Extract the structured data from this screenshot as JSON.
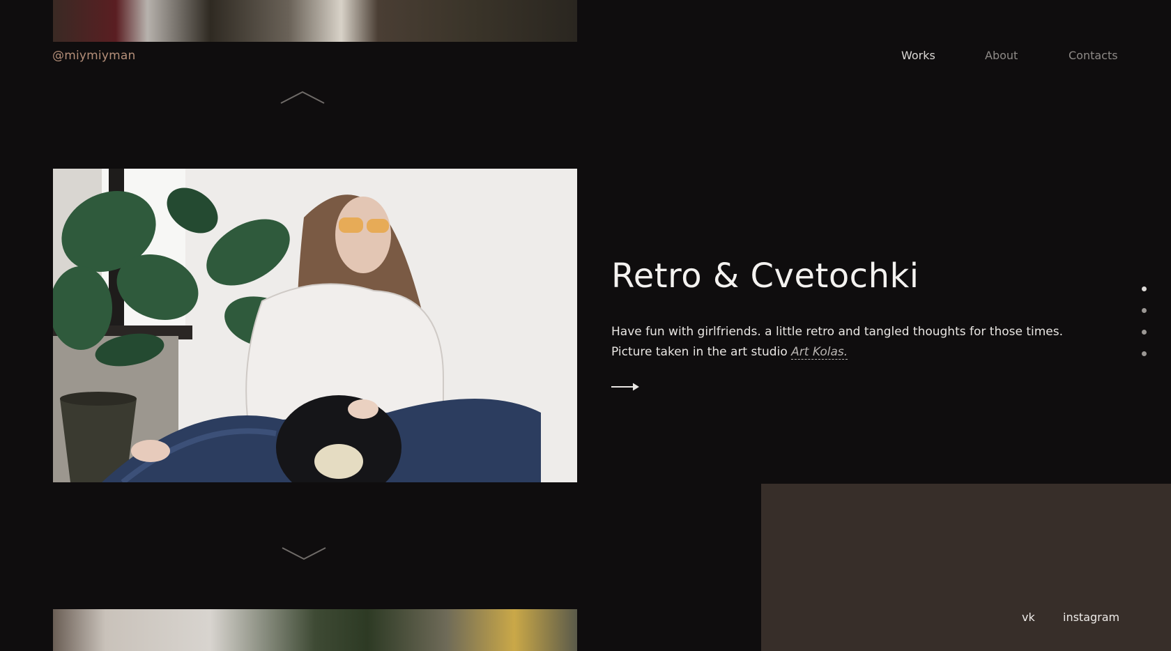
{
  "header": {
    "brand": "@miymiyman",
    "nav": [
      {
        "label": "Works",
        "active": true
      },
      {
        "label": "About",
        "active": false
      },
      {
        "label": "Contacts",
        "active": false
      }
    ]
  },
  "slide": {
    "title": "Retro & Cvetochki",
    "description_pre": "Have fun with girlfriends. a little retro and tangled thoughts for those times. Picture taken in the art studio ",
    "link_text": "Art Kolas.",
    "image_alt": "Woman in sunglasses holding a vinyl record next to a monstera plant"
  },
  "pagination": {
    "count": 4,
    "active_index": 0
  },
  "footer": {
    "social": [
      {
        "label": "vk"
      },
      {
        "label": "instagram"
      }
    ]
  },
  "colors": {
    "background": "#0f0d0e",
    "panel": "#372e29",
    "brand": "#b58f79",
    "text": "#f4f2f0",
    "muted": "#8e8a87"
  },
  "icons": [
    "chevron-up-icon",
    "chevron-down-icon",
    "arrow-right-icon"
  ]
}
